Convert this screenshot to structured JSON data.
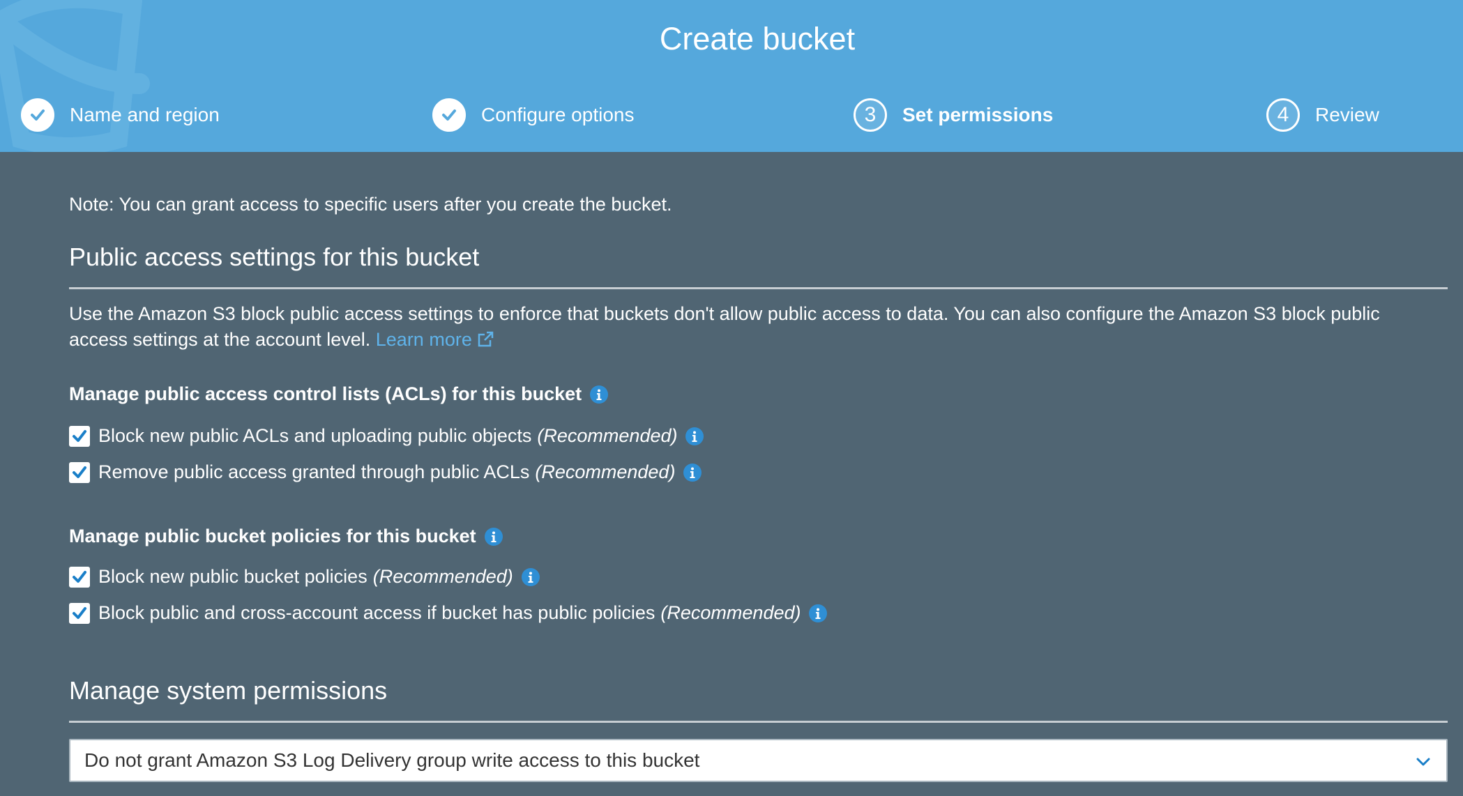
{
  "header": {
    "title": "Create bucket",
    "steps": [
      {
        "label": "Name and region",
        "state": "complete"
      },
      {
        "label": "Configure options",
        "state": "complete"
      },
      {
        "label": "Set permissions",
        "number": "3",
        "state": "active"
      },
      {
        "label": "Review",
        "number": "4",
        "state": "pending"
      }
    ]
  },
  "main": {
    "note": "Note: You can grant access to specific users after you create the bucket.",
    "public_access": {
      "title": "Public access settings for this bucket",
      "description": "Use the Amazon S3 block public access settings to enforce that buckets don't allow public access to data. You can also configure the Amazon S3 block public access settings at the account level.",
      "learn_more": "Learn more",
      "acl_group": {
        "title": "Manage public access control lists (ACLs) for this bucket",
        "options": [
          {
            "label": "Block new public ACLs and uploading public objects",
            "tag": "(Recommended)",
            "checked": true
          },
          {
            "label": "Remove public access granted through public ACLs",
            "tag": "(Recommended)",
            "checked": true
          }
        ]
      },
      "policy_group": {
        "title": "Manage public bucket policies for this bucket",
        "options": [
          {
            "label": "Block new public bucket policies",
            "tag": "(Recommended)",
            "checked": true
          },
          {
            "label": "Block public and cross-account access if bucket has public policies",
            "tag": "(Recommended)",
            "checked": true
          }
        ]
      }
    },
    "system_permissions": {
      "title": "Manage system permissions",
      "selected": "Do not grant Amazon S3 Log Delivery group write access to this bucket"
    }
  },
  "colors": {
    "header_bg": "#55a8dc",
    "page_bg": "#506573",
    "link": "#5fb3ea",
    "info_icon": "#2f8fd5",
    "check": "#1a7fc8"
  },
  "icons": {
    "step_complete": "check-circle-icon",
    "info": "info-icon",
    "external_link": "external-link-icon",
    "dropdown": "chevron-down-icon",
    "checkbox": "checkbox-checked-icon"
  }
}
